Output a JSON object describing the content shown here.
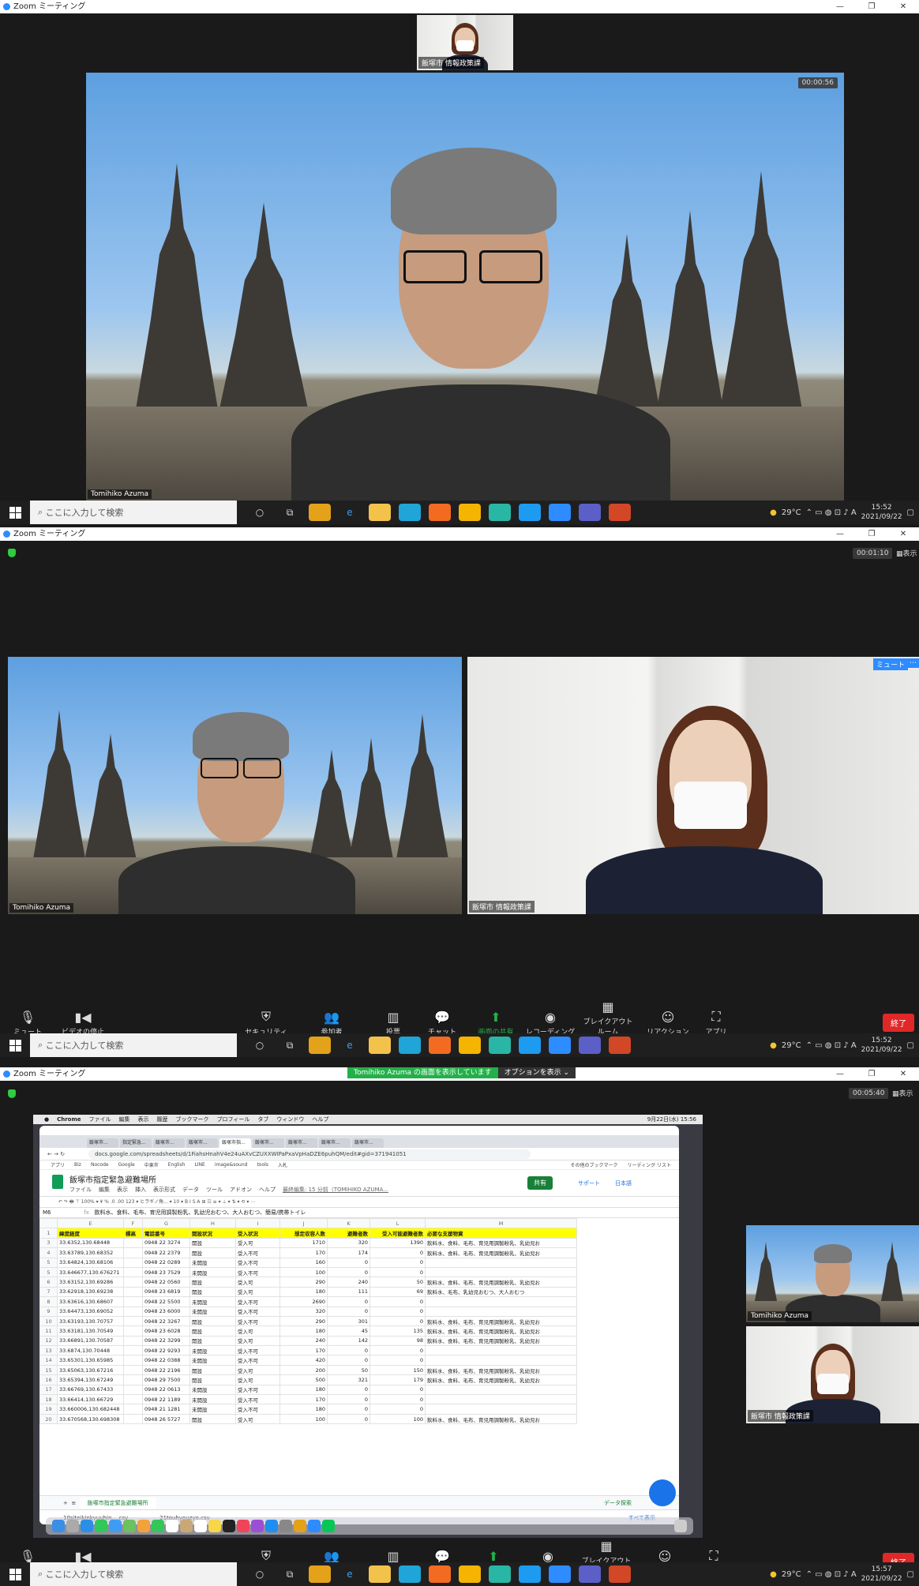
{
  "windows": [
    {
      "title": "Zoom ミーティング",
      "timer": "00:00:56",
      "thumbnail_name": "飯塚市 情報政策課",
      "main_name": "Tomihiko Azuma"
    },
    {
      "title": "Zoom ミーティング",
      "timer": "00:01:10",
      "view_label": "表示",
      "left_name": "Tomihiko Azuma",
      "right_name": "飯塚市 情報政策課",
      "mute_badge": "ミュート"
    },
    {
      "title": "Zoom ミーティング",
      "timer": "00:05:40",
      "view_label": "表示",
      "banner_text": "Tomihiko Azuma の画面を表示しています",
      "banner_options": "オプションを表示 ⌄",
      "thumb1_name": "Tomihiko Azuma",
      "thumb2_name": "飯塚市 情報政策課"
    }
  ],
  "window_controls": {
    "minimize": "—",
    "maximize": "❐",
    "close": "✕"
  },
  "controls": {
    "mute": "ミュート",
    "video": "ビデオの停止",
    "security": "セキュリティ",
    "participants": "参加者",
    "participants_count": "2",
    "poll": "投票",
    "chat": "チャット",
    "share": "画面の共有",
    "record": "レコーディング",
    "breakout": "ブレイクアウトルーム",
    "reactions": "リアクション",
    "apps": "アプリ",
    "end": "終了"
  },
  "taskbars": [
    {
      "search": "ここに入力して検索",
      "temp": "29°C",
      "time": "15:52",
      "date": "2021/09/22"
    },
    {
      "search": "ここに入力して検索",
      "temp": "29°C",
      "time": "15:52",
      "date": "2021/09/22"
    },
    {
      "search": "ここに入力して検索",
      "temp": "29°C",
      "time": "15:57",
      "date": "2021/09/22"
    }
  ],
  "shared": {
    "mac_menu": [
      "Chrome",
      "ファイル",
      "編集",
      "表示",
      "履歴",
      "ブックマーク",
      "プロフィール",
      "タブ",
      "ウィンドウ",
      "ヘルプ"
    ],
    "mac_clock": "9月22日(水) 15:56",
    "tab_labels": [
      "飯塚市...",
      "指定緊急...",
      "飯塚市...",
      "飯塚市...",
      "飯塚市指...",
      "飯塚市...",
      "飯塚市...",
      "飯塚市...",
      "飯塚市..."
    ],
    "url": "docs.google.com/spreadsheets/d/1FiahsHnahV4e24uAXvCZUXXWIPaPxaVpHaDZE6puhQM/edit#gid=371941051",
    "bookmarks": [
      "アプリ",
      "Biz",
      "Nocode",
      "Google",
      "中東市",
      "English",
      "LINE",
      "image&sound",
      "tools",
      "入札",
      "その他のブックマーク",
      "リーディング リスト"
    ],
    "doc_title": "飯塚市指定緊急避難場所",
    "doc_menu": [
      "ファイル",
      "編集",
      "表示",
      "挿入",
      "表示形式",
      "データ",
      "ツール",
      "アドオン",
      "ヘルプ"
    ],
    "last_edit": "最終編集: 15 分前（TOMIHIKO AZUMA...",
    "share_btn": "共有",
    "support": "サポート",
    "lang": "日本語",
    "toolbar_text": "↶  ↷  🖶  ⊤   100% ▾   ¥  %  .0  .00  123 ▾   ヒラギノ角... ▾   10 ▾   B  I  S  A   ⊞  ☷  ≡ ▾  ⊥ ▾  ⇅ ▾  ⟲ ▾   ⋯",
    "cell_ref": "M6",
    "formula": "飲料水、食料、毛布、育児用調製粉乳、乳幼児おむつ、大人おむつ、簡易/携帯トイレ",
    "col_letters": [
      "",
      "E",
      "F",
      "G",
      "H",
      "I",
      "J",
      "K",
      "L",
      "M"
    ],
    "header_row": [
      "1",
      "緯度経度",
      "標高",
      "電話番号",
      "開設状況",
      "受入状況",
      "想定収容人数",
      "避難者数",
      "受入可能避難者数",
      "必要な支援物資"
    ],
    "rows": [
      [
        "3",
        "33.6352,130.68448",
        "",
        "0948 22 3274",
        "開設",
        "受入可",
        "1710",
        "320",
        "1390",
        "飲料水、食料、毛布、育児用調製粉乳、乳幼児お"
      ],
      [
        "4",
        "33.63789,130.68352",
        "",
        "0948 22 2379",
        "開設",
        "受入不可",
        "170",
        "174",
        "0",
        "飲料水、食料、毛布、育児用調製粉乳、乳幼児お"
      ],
      [
        "5",
        "33.64824,130.68106",
        "",
        "0948 22 0289",
        "未開設",
        "受入不可",
        "160",
        "0",
        "0",
        ""
      ],
      [
        "5",
        "33.646677,130.676271",
        "",
        "0948 23 7529",
        "未開設",
        "受入不可",
        "100",
        "0",
        "0",
        ""
      ],
      [
        "6",
        "33.63152,130.69286",
        "",
        "0948 22 0560",
        "開設",
        "受入可",
        "290",
        "240",
        "50",
        "飲料水、食料、毛布、育児用調製粉乳、乳幼児お"
      ],
      [
        "7",
        "33.62918,130.69238",
        "",
        "0948 23 6819",
        "開設",
        "受入可",
        "180",
        "111",
        "69",
        "飲料水、毛布、乳幼児おむつ、大人おむつ"
      ],
      [
        "8",
        "33.63616,130.68607",
        "",
        "0948 22 5500",
        "未開設",
        "受入不可",
        "2690",
        "0",
        "0",
        ""
      ],
      [
        "9",
        "33.64473,130.69052",
        "",
        "0948 23 6000",
        "未開設",
        "受入不可",
        "320",
        "0",
        "0",
        ""
      ],
      [
        "10",
        "33.63193,130.70757",
        "",
        "0948 22 3267",
        "開設",
        "受入不可",
        "290",
        "301",
        "0",
        "飲料水、食料、毛布、育児用調製粉乳、乳幼児お"
      ],
      [
        "11",
        "33.63181,130.70549",
        "",
        "0948 23 6028",
        "開設",
        "受入可",
        "180",
        "45",
        "135",
        "飲料水、食料、毛布、育児用調製粉乳、乳幼児お"
      ],
      [
        "12",
        "33.66891,130.70587",
        "",
        "0948 22 3299",
        "開設",
        "受入可",
        "240",
        "142",
        "98",
        "飲料水、食料、毛布、育児用調製粉乳、乳幼児お"
      ],
      [
        "13",
        "33.6874,130.70448",
        "",
        "0948 22 9293",
        "未開設",
        "受入不可",
        "170",
        "0",
        "0",
        ""
      ],
      [
        "14",
        "33.65301,130.65985",
        "",
        "0948 22 0388",
        "未開設",
        "受入不可",
        "420",
        "0",
        "0",
        ""
      ],
      [
        "15",
        "33.65063,130.67216",
        "",
        "0948 22 2196",
        "開設",
        "受入可",
        "200",
        "50",
        "150",
        "飲料水、食料、毛布、育児用調製粉乳、乳幼児お"
      ],
      [
        "16",
        "33.65394,130.67249",
        "",
        "0948 29 7500",
        "開設",
        "受入可",
        "500",
        "321",
        "179",
        "飲料水、食料、毛布、育児用調製粉乳、乳幼児お"
      ],
      [
        "17",
        "33.66769,130.67433",
        "",
        "0948 22 0613",
        "未開設",
        "受入不可",
        "180",
        "0",
        "0",
        ""
      ],
      [
        "18",
        "33.66414,130.66729",
        "",
        "0948 22 1189",
        "未開設",
        "受入不可",
        "170",
        "0",
        "0",
        ""
      ],
      [
        "19",
        "33.660006,130.682448",
        "",
        "0948 21 1281",
        "未開設",
        "受入不可",
        "180",
        "0",
        "0",
        ""
      ],
      [
        "20",
        "33.670568,130.698308",
        "",
        "0948 26 5727",
        "開設",
        "受入可",
        "100",
        "0",
        "100",
        "飲料水、食料、毛布、育児用調製粉乳、乳幼児お"
      ]
    ],
    "sheet_tab": "飯塚市指定緊急避難場所",
    "explore": "データ探索",
    "downloads": [
      "10siteikinkyuuhin....csv",
      "21touhyouzyo.csv"
    ],
    "show_all": "すべて表示"
  }
}
